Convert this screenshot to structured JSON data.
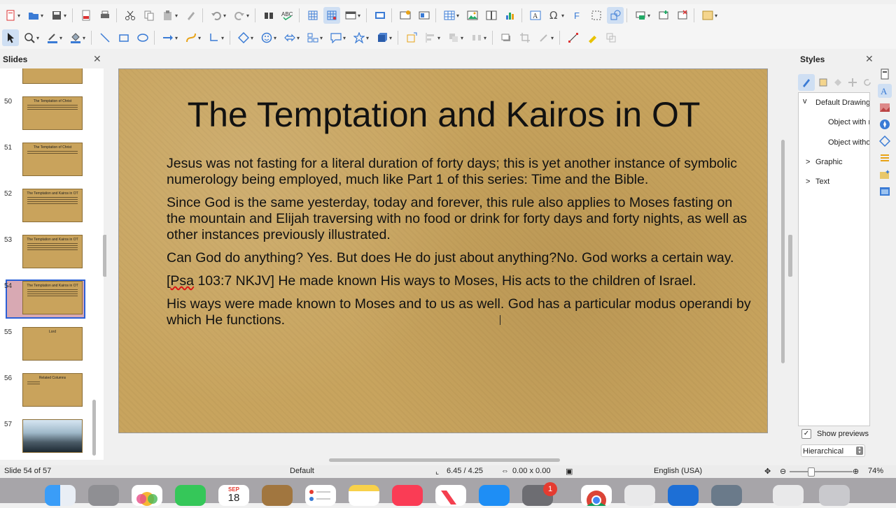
{
  "toolbar1": {
    "items": [
      "new-icon",
      "open-icon",
      "save-icon",
      "export-pdf-icon",
      "print-icon",
      "cut-icon",
      "copy-icon",
      "paste-icon",
      "clone-formatting-icon",
      "undo-icon",
      "redo-icon",
      "find-replace-icon",
      "spelling-icon",
      "grid-icon",
      "helplines-icon",
      "display-views-icon",
      "master-slide-icon",
      "start-slideshow-icon",
      "table-icon",
      "image-icon",
      "media-icon",
      "chart-icon",
      "textbox-icon",
      "special-character-icon",
      "fontwork-icon",
      "transformations-icon",
      "align-objects-icon",
      "arrange-icon",
      "delete-icon",
      "slide-layout-icon"
    ]
  },
  "toolbar2": {
    "items": [
      "select-icon",
      "zoom-pan-icon",
      "line-color-icon",
      "fill-color-icon",
      "line-icon",
      "rectangle-icon",
      "ellipse-icon",
      "line-arrow-icon",
      "curve-icon",
      "connector-icon",
      "basic-shapes-icon",
      "symbol-shapes-icon",
      "block-arrows-icon",
      "flowchart-icon",
      "callout-icon",
      "stars-icon",
      "3d-objects-icon",
      "rotate-icon",
      "align-icon",
      "arrange-icon",
      "distribute-icon",
      "shadow-icon",
      "crop-icon",
      "filter-icon",
      "points-icon",
      "glue-points-icon",
      "toggle-extrusion-icon"
    ]
  },
  "slides_panel": {
    "title": "Slides",
    "close_icon": "close-icon",
    "items": [
      {
        "number": "50",
        "title": "The Temptation of Christ"
      },
      {
        "number": "51",
        "title": "The Temptation of Christ"
      },
      {
        "number": "52",
        "title": "The Temptation and Kairos in OT"
      },
      {
        "number": "53",
        "title": "The Temptation and Kairos in OT"
      },
      {
        "number": "54",
        "title": "The Temptation and Kairos in OT",
        "selected": true
      },
      {
        "number": "55",
        "title": "Lord"
      },
      {
        "number": "56",
        "title": "Related Columns"
      },
      {
        "number": "57",
        "title": ""
      }
    ]
  },
  "slide": {
    "title": "The Temptation and Kairos in OT",
    "paragraphs": [
      "Jesus was not fasting for a literal duration of forty days; this is yet another instance of symbolic numerology being employed, much like Part 1 of this series: Time and the Bible.",
      "Since God is the same yesterday, today and forever, this rule also applies to Moses fasting on the mountain and Elijah traversing with no food or drink for forty days and forty nights, as well as other instances previously illustrated.",
      "Can God do anything? Yes. But does He do just about anything?No. God works a certain way.",
      "[Psa 103:7 NKJV] He made known His ways to Moses, His acts to the children of Israel.",
      "His ways were made known to Moses and to us as well. God has a particular modus operandi by which He functions."
    ],
    "para4_prefix": "[",
    "para4_wavy": "Psa",
    "para4_rest": " 103:7 NKJV] He made known His ways to Moses, His acts to the children of Israel."
  },
  "styles_panel": {
    "title": "Styles",
    "close_icon": "close-icon",
    "tree": [
      {
        "label": "Default Drawing Style",
        "expander": "v"
      },
      {
        "label": "Object with no fill and no line",
        "expander": ""
      },
      {
        "label": "Object without fill",
        "expander": ""
      },
      {
        "label": "Graphic",
        "expander": ">"
      },
      {
        "label": "Text",
        "expander": ">"
      }
    ],
    "show_previews_label": "Show previews",
    "show_previews_checked": true,
    "filter_value": "Hierarchical"
  },
  "statusbar": {
    "slide_info": "Slide 54 of 57",
    "master": "Default",
    "position": "6.45 / 4.25",
    "size": "0.00 x 0.00",
    "language": "English (USA)",
    "zoom": "74%"
  },
  "dock": {
    "calendar_month": "SEP",
    "calendar_day": "18",
    "badge": "1",
    "apps": [
      "finder-icon",
      "launchpad-icon",
      "photos-icon",
      "facetime-icon",
      "calendar-icon",
      "contacts-icon",
      "reminders-icon",
      "notes-icon",
      "music-icon",
      "news-icon",
      "app-store-icon",
      "system-settings-icon",
      "chrome-icon",
      "preview-icon",
      "libreoffice-icon",
      "utility-icon",
      "screenshot-icon",
      "trash-icon"
    ]
  },
  "colors": {
    "slide_bg": "#c8a45e",
    "selection_border": "#2b60d6",
    "selected_thumb_bg": "#d8a9b3",
    "dock_bg": "#a7a5a9"
  }
}
